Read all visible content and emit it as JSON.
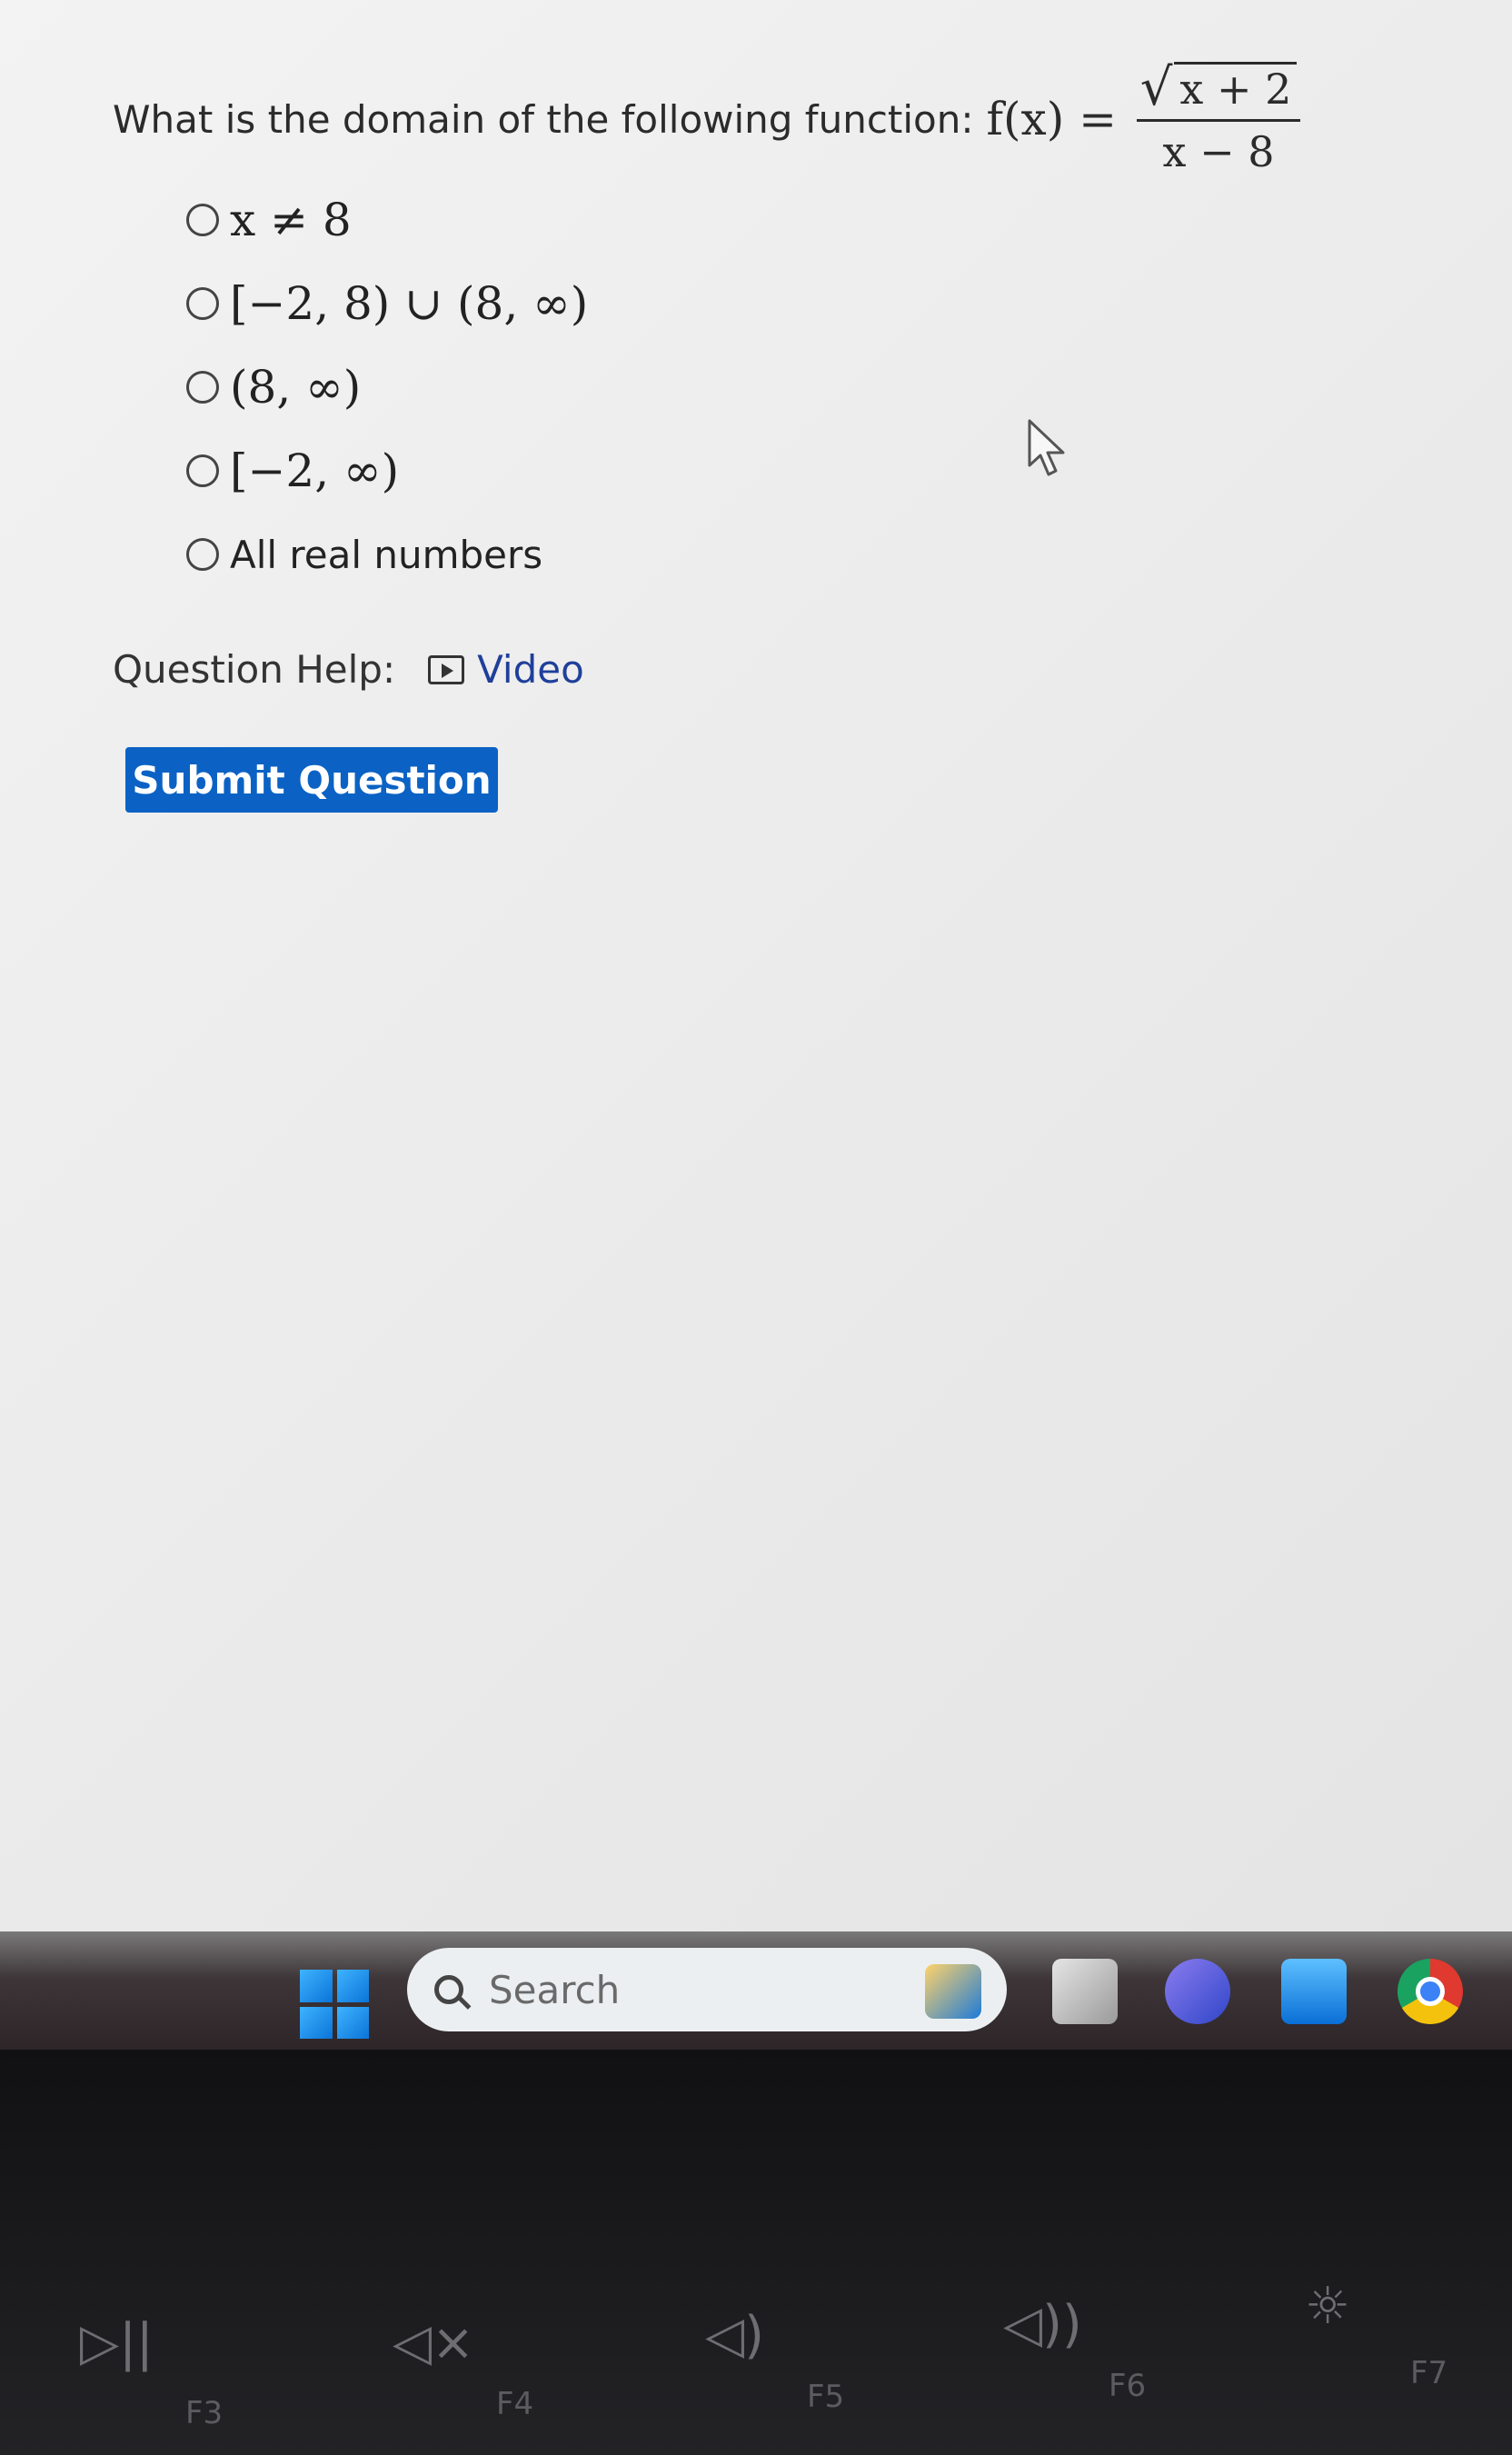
{
  "question": {
    "prompt": "What is the domain of the following function:",
    "fx": "f(x) =",
    "numerator": "x + 2",
    "denominator": "x − 8"
  },
  "options": [
    {
      "label": "x ≠ 8",
      "math": true
    },
    {
      "label": "[−2, 8) ∪ (8, ∞)",
      "math": true
    },
    {
      "label": "(8, ∞)",
      "math": true
    },
    {
      "label": "[−2, ∞)",
      "math": true
    },
    {
      "label": "All real numbers",
      "math": false
    }
  ],
  "help": {
    "label": "Question Help:",
    "video_label": "Video"
  },
  "submit_label": "Submit Question",
  "taskbar": {
    "search_placeholder": "Search"
  },
  "keyboard": {
    "keys": [
      {
        "glyph": "▷||",
        "label": "F3"
      },
      {
        "glyph": "◁×",
        "label": "F4"
      },
      {
        "glyph": "◁)",
        "label": "F5"
      },
      {
        "glyph": "◁))",
        "label": "F6"
      },
      {
        "glyph": "☼",
        "label": "F7"
      }
    ]
  },
  "colors": {
    "submit_bg": "#0b62c4",
    "link": "#1f3f9a"
  }
}
